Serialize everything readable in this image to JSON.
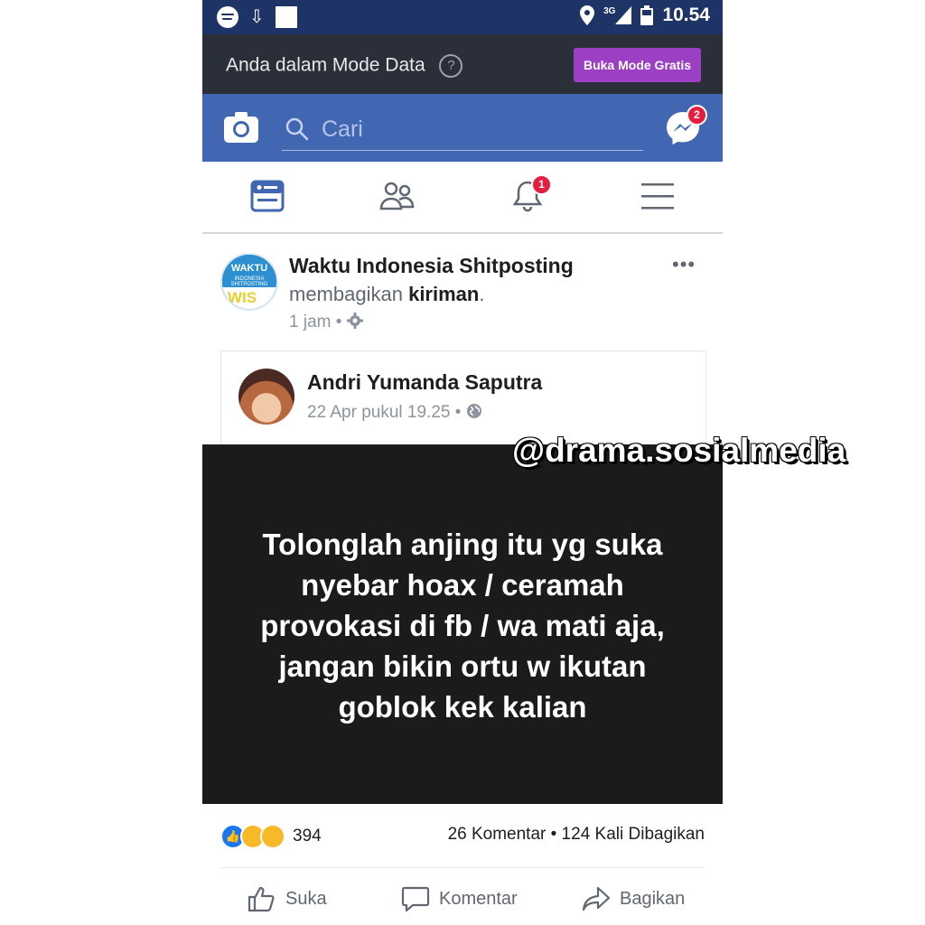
{
  "status_bar": {
    "network": "3G",
    "time": "10.54"
  },
  "data_mode": {
    "text": "Anda dalam Mode Data",
    "help": "?",
    "button": "Buka Mode Gratis"
  },
  "header": {
    "search_placeholder": "Cari",
    "messenger_badge": "2"
  },
  "nav": {
    "notifications_badge": "1"
  },
  "post": {
    "page_name": "Waktu Indonesia Shitposting",
    "shared_prefix": "membagikan",
    "shared_object": "kiriman",
    "shared_suffix": ".",
    "time": "1 jam •",
    "avatar_top": "WAKTU",
    "avatar_mid": "INDONESIA SHITPOSTING",
    "avatar_bottom": "WIS",
    "more": "•••"
  },
  "shared": {
    "author": "Andri Yumanda Saputra",
    "time": "22 Apr pukul 19.25 •"
  },
  "image_text": "Tolonglah anjing itu yg suka nyebar hoax / ceramah provokasi di fb / wa mati aja, jangan bikin ortu w ikutan goblok kek kalian",
  "reactions": {
    "count": "394",
    "stats": "26 Komentar • 124 Kali Dibagikan"
  },
  "actions": {
    "like": "Suka",
    "comment": "Komentar",
    "share": "Bagikan"
  },
  "watermark": "@drama.sosialmedia",
  "colors": {
    "fb_blue": "#4267b2",
    "status_bar": "#1f3466",
    "data_bar": "#2b2f3a",
    "free_button": "#9c3fc3",
    "badge": "#e41e3f"
  }
}
